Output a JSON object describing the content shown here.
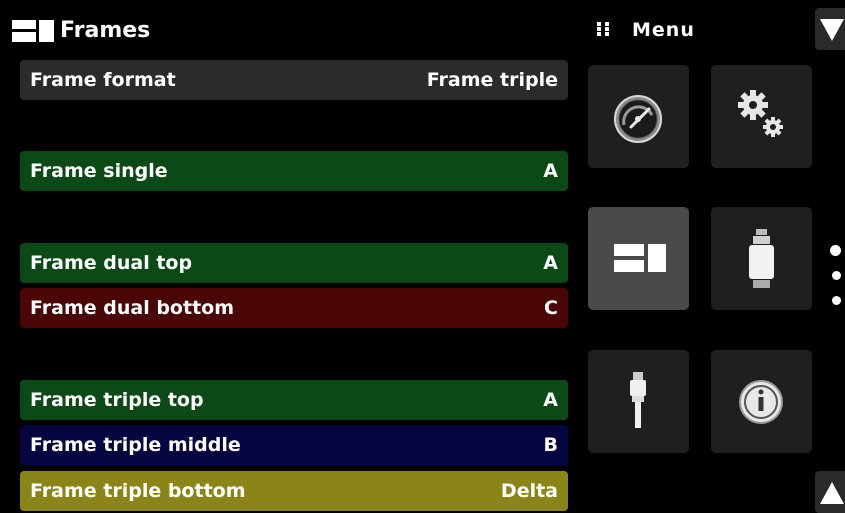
{
  "header": {
    "title": "Frames",
    "title_icon": "frames-icon",
    "menu_label": "Menu",
    "menu_icon": "grid-dots-icon"
  },
  "rows": [
    {
      "label": "Frame format",
      "value": "Frame triple",
      "color": "#2b2b2b"
    },
    {
      "label": "Frame single",
      "value": "A",
      "color": "#0b4a16"
    },
    {
      "label": "Frame dual top",
      "value": "A",
      "color": "#0b4a16"
    },
    {
      "label": "Frame dual bottom",
      "value": "C",
      "color": "#4a0505"
    },
    {
      "label": "Frame triple top",
      "value": "A",
      "color": "#0b4a16"
    },
    {
      "label": "Frame triple middle",
      "value": "B",
      "color": "#05053f"
    },
    {
      "label": "Frame triple bottom",
      "value": "Delta",
      "color": "#8b8518"
    }
  ],
  "menu_tiles": [
    {
      "icon": "gauge-icon",
      "active": false
    },
    {
      "icon": "gears-icon",
      "active": false
    },
    {
      "icon": "frames-icon",
      "active": true
    },
    {
      "icon": "sensor-module-icon",
      "active": false
    },
    {
      "icon": "cable-connector-icon",
      "active": false
    },
    {
      "icon": "info-icon",
      "active": false
    }
  ],
  "scroll": {
    "up_icon": "triangle-up-icon",
    "down_icon": "triangle-down-icon"
  },
  "page_indicator": {
    "pages": 3
  }
}
